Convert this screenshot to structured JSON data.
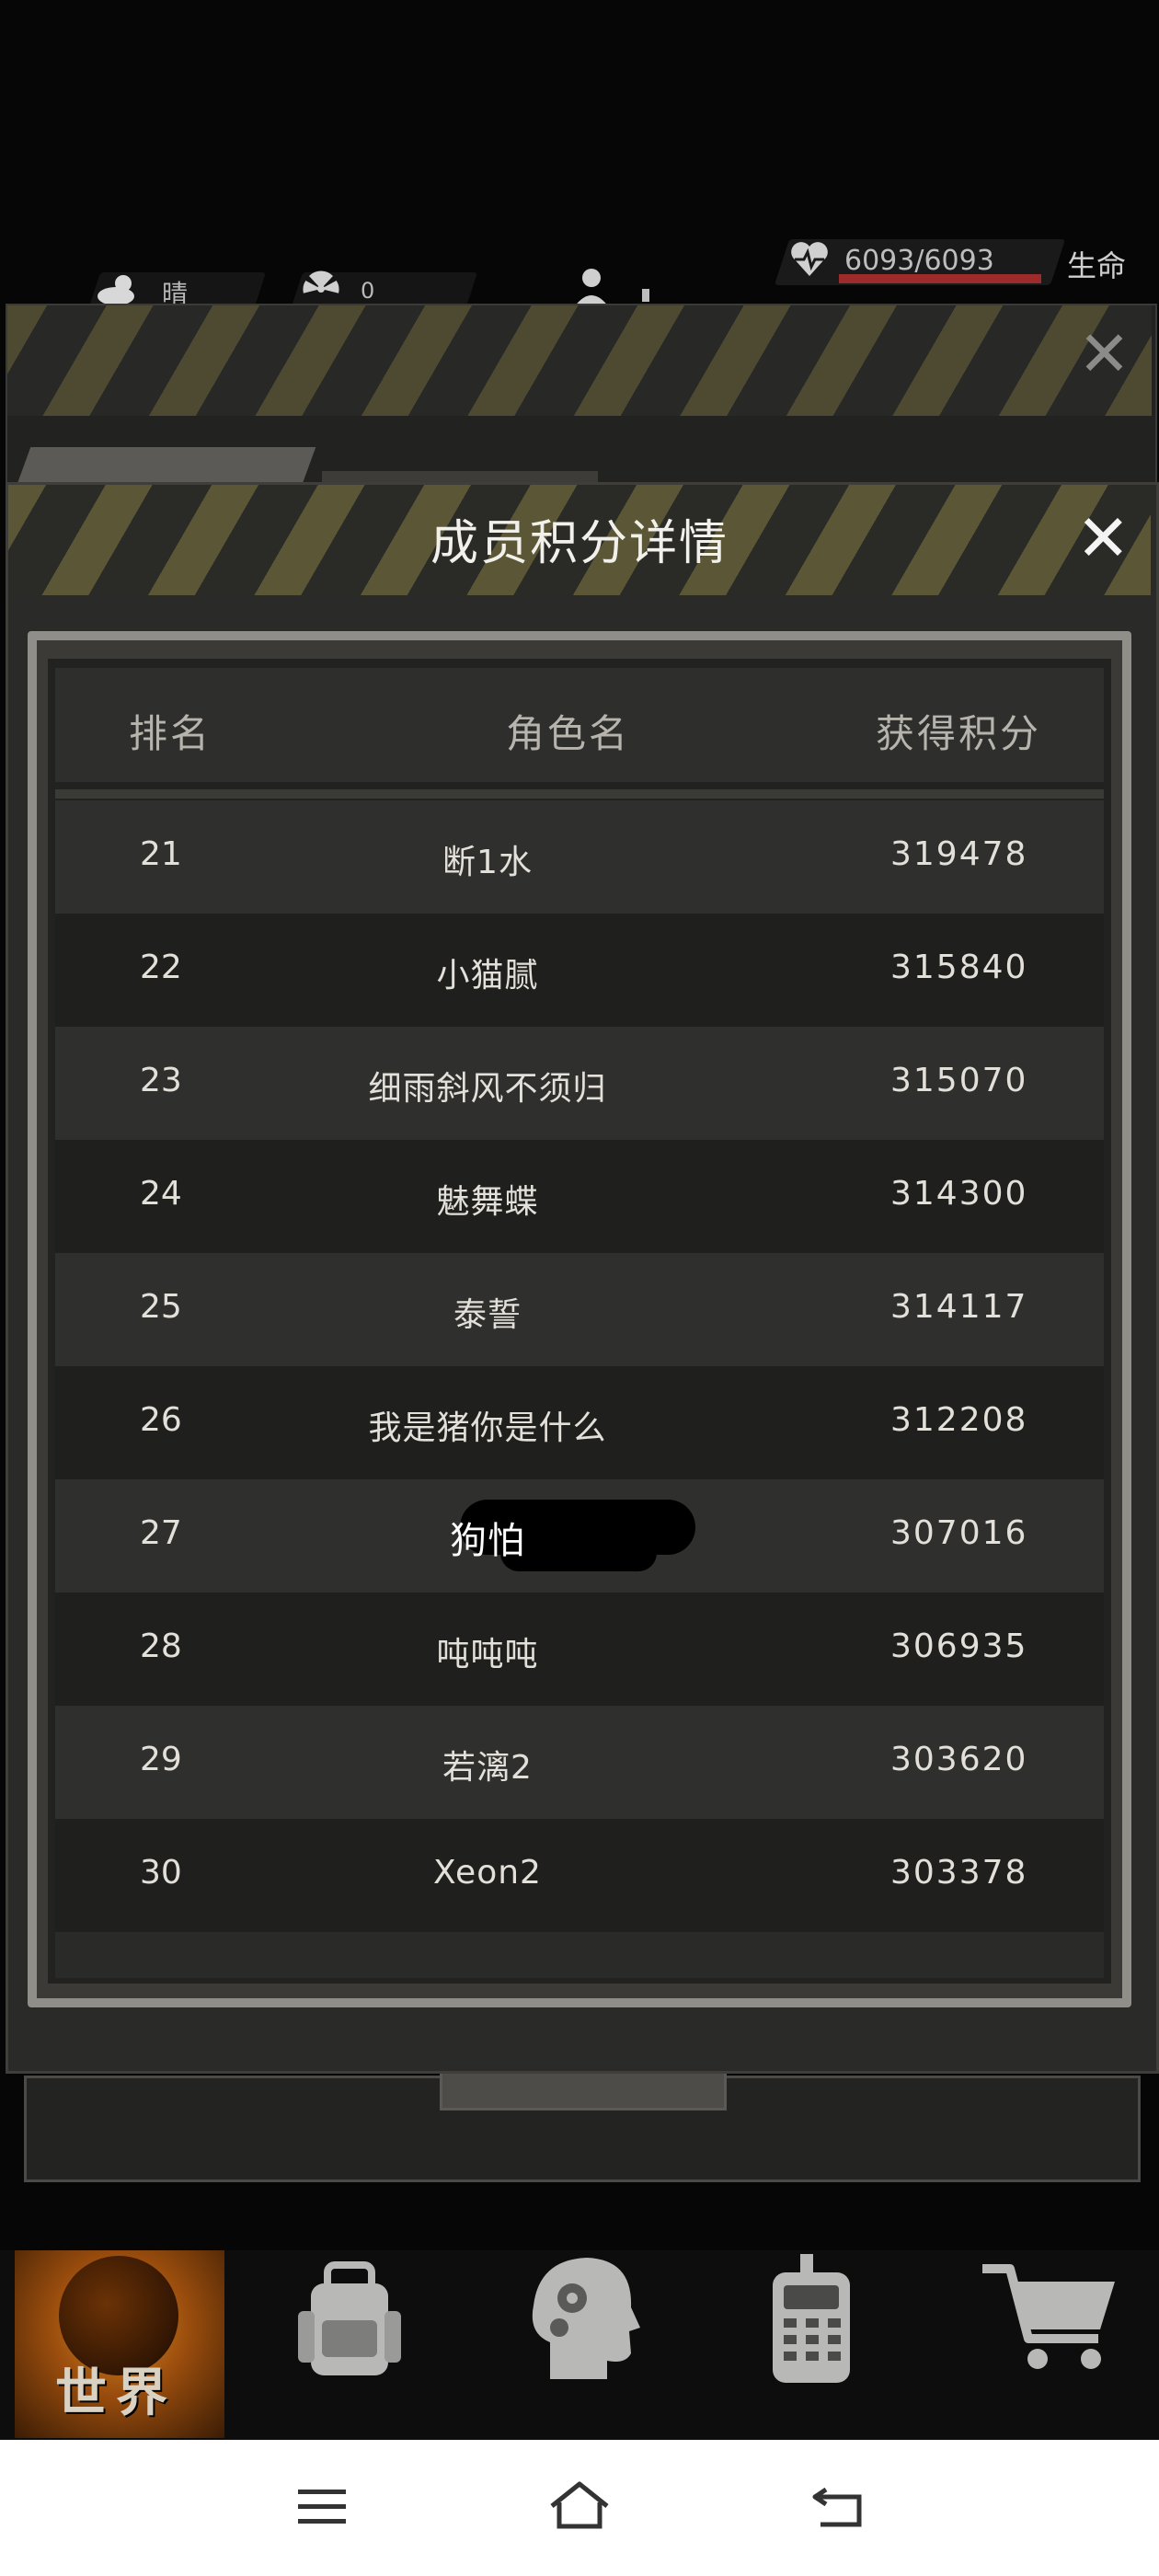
{
  "status": {
    "weather_label": "晴",
    "radiation_value": "0",
    "hp_text": "6093/6093",
    "hp_label": "生命"
  },
  "modal": {
    "title": "成员积分详情",
    "columns": [
      "排名",
      "角色名",
      "获得积分"
    ]
  },
  "rows": [
    {
      "rank": "21",
      "name": "断1水",
      "score": "319478"
    },
    {
      "rank": "22",
      "name": "小猫腻",
      "score": "315840"
    },
    {
      "rank": "23",
      "name": "细雨斜风不须归",
      "score": "315070"
    },
    {
      "rank": "24",
      "name": "魅舞蝶",
      "score": "314300"
    },
    {
      "rank": "25",
      "name": "泰誓",
      "score": "314117"
    },
    {
      "rank": "26",
      "name": "我是猪你是什么",
      "score": "312208"
    },
    {
      "rank": "27",
      "name": "狗怕",
      "score": "307016"
    },
    {
      "rank": "28",
      "name": "吨吨吨",
      "score": "306935"
    },
    {
      "rank": "29",
      "name": "若漓2",
      "score": "303620"
    },
    {
      "rank": "30",
      "name": "Xeon2",
      "score": "303378"
    }
  ],
  "bottom_nav": {
    "world_label": "世界",
    "icons": [
      "backpack-icon",
      "skills-head-icon",
      "radio-icon",
      "shop-cart-icon"
    ]
  },
  "system_nav": {
    "icons": [
      "menu-icon",
      "home-icon",
      "back-icon"
    ]
  },
  "colors": {
    "accent_hp": "#9e2b2b",
    "hazard_yellow": "#5b5736",
    "world_orange": "#d68a22"
  }
}
